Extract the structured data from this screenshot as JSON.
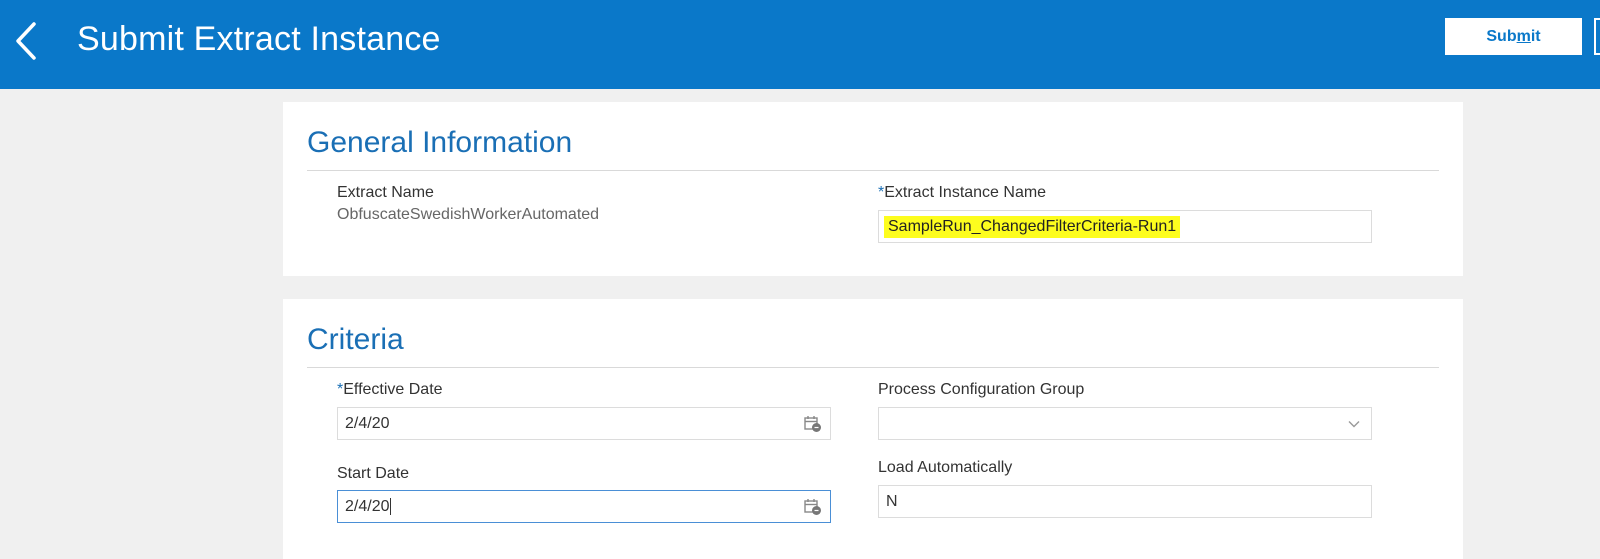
{
  "header": {
    "title": "Submit Extract Instance",
    "submit_label_pre": "Sub",
    "submit_label_mnemonic": "m",
    "submit_label_post": "it",
    "bg_color": "#0a78c9"
  },
  "general": {
    "title": "General Information",
    "extract_name_label": "Extract Name",
    "extract_name_value": "ObfuscateSwedishWorkerAutomated",
    "required_mark": "*",
    "instance_name_label": "Extract Instance Name",
    "instance_name_value": "SampleRun_ChangedFilterCriteria-Run1"
  },
  "criteria": {
    "title": "Criteria",
    "required_mark": "*",
    "effective_date_label": "Effective Date",
    "effective_date_value": "2/4/20",
    "start_date_label": "Start Date",
    "start_date_value": "2/4/20",
    "process_config_label": "Process Configuration Group",
    "process_config_value": "",
    "load_auto_label": "Load Automatically",
    "load_auto_value": "N"
  },
  "icons": {
    "back": "chevron-left-icon",
    "calendar": "calendar-icon",
    "dropdown": "chevron-down-icon"
  }
}
